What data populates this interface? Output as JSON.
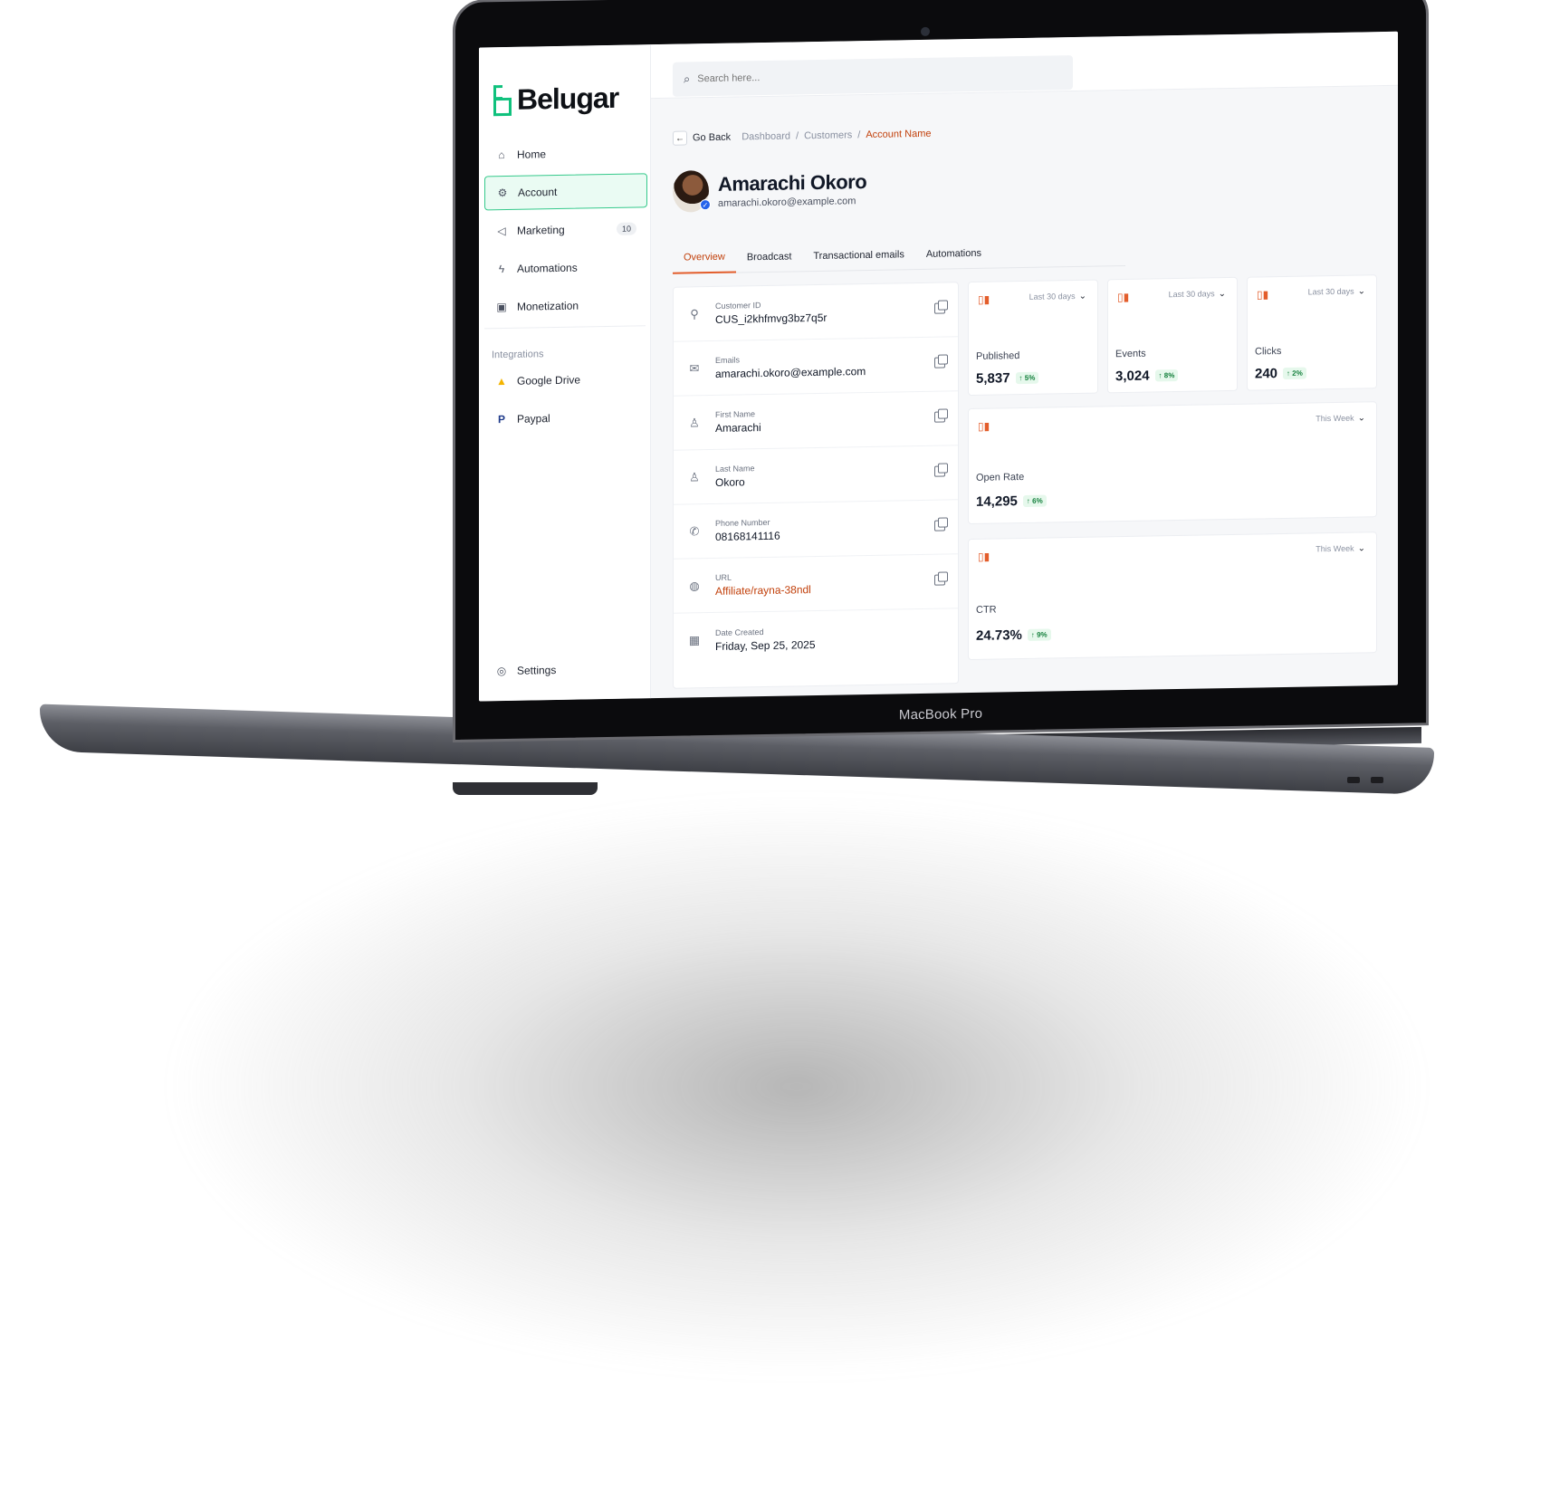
{
  "device": {
    "label": "MacBook Pro"
  },
  "app": {
    "brand": "Belugar",
    "search": {
      "placeholder": "Search here..."
    }
  },
  "sidebar": {
    "items": [
      {
        "label": "Home",
        "icon": "home-icon"
      },
      {
        "label": "Account",
        "icon": "account-icon",
        "active": true
      },
      {
        "label": "Marketing",
        "icon": "megaphone-icon",
        "badge": "10"
      },
      {
        "label": "Automations",
        "icon": "lightning-icon"
      },
      {
        "label": "Monetization",
        "icon": "money-icon"
      }
    ],
    "integrations_title": "Integrations",
    "integrations": [
      {
        "label": "Google Drive",
        "icon": "google-drive-icon"
      },
      {
        "label": "Paypal",
        "icon": "paypal-icon"
      }
    ],
    "settings_label": "Settings"
  },
  "breadcrumb": {
    "back_label": "Go Back",
    "items": [
      "Dashboard",
      "Customers",
      "Account Name"
    ]
  },
  "profile": {
    "name": "Amarachi Okoro",
    "email": "amarachi.okoro@example.com"
  },
  "tabs": [
    "Overview",
    "Broadcast",
    "Transactional emails",
    "Automations"
  ],
  "details": [
    {
      "label": "Customer ID",
      "value": "CUS_i2khfmvg3bz7q5r",
      "icon": "id-icon"
    },
    {
      "label": "Emails",
      "value": "amarachi.okoro@example.com",
      "icon": "mail-icon"
    },
    {
      "label": "First Name",
      "value": "Amarachi",
      "icon": "user-icon"
    },
    {
      "label": "Last Name",
      "value": "Okoro",
      "icon": "user-icon"
    },
    {
      "label": "Phone Number",
      "value": "08168141116",
      "icon": "phone-icon"
    },
    {
      "label": "URL",
      "value": "Affiliate/rayna-38ndl",
      "icon": "globe-icon"
    },
    {
      "label": "Date Created",
      "value": "Friday, Sep 25, 2025",
      "icon": "calendar-icon"
    }
  ],
  "stats": [
    {
      "period": "Last 30 days",
      "label": "Published",
      "value": "5,837",
      "trend": "5%"
    },
    {
      "period": "Last 30 days",
      "label": "Events",
      "value": "3,024",
      "trend": "8%"
    },
    {
      "period": "Last 30 days",
      "label": "Clicks",
      "value": "240",
      "trend": "2%"
    },
    {
      "period": "This Week",
      "label": "Open Rate",
      "value": "14,295",
      "trend": "6%"
    },
    {
      "period": "This Week",
      "label": "CTR",
      "value": "24.73%",
      "trend": "9%"
    }
  ],
  "colors": {
    "accent": "#e35d2b",
    "brand": "#10c17d",
    "positive": "#15803d"
  }
}
